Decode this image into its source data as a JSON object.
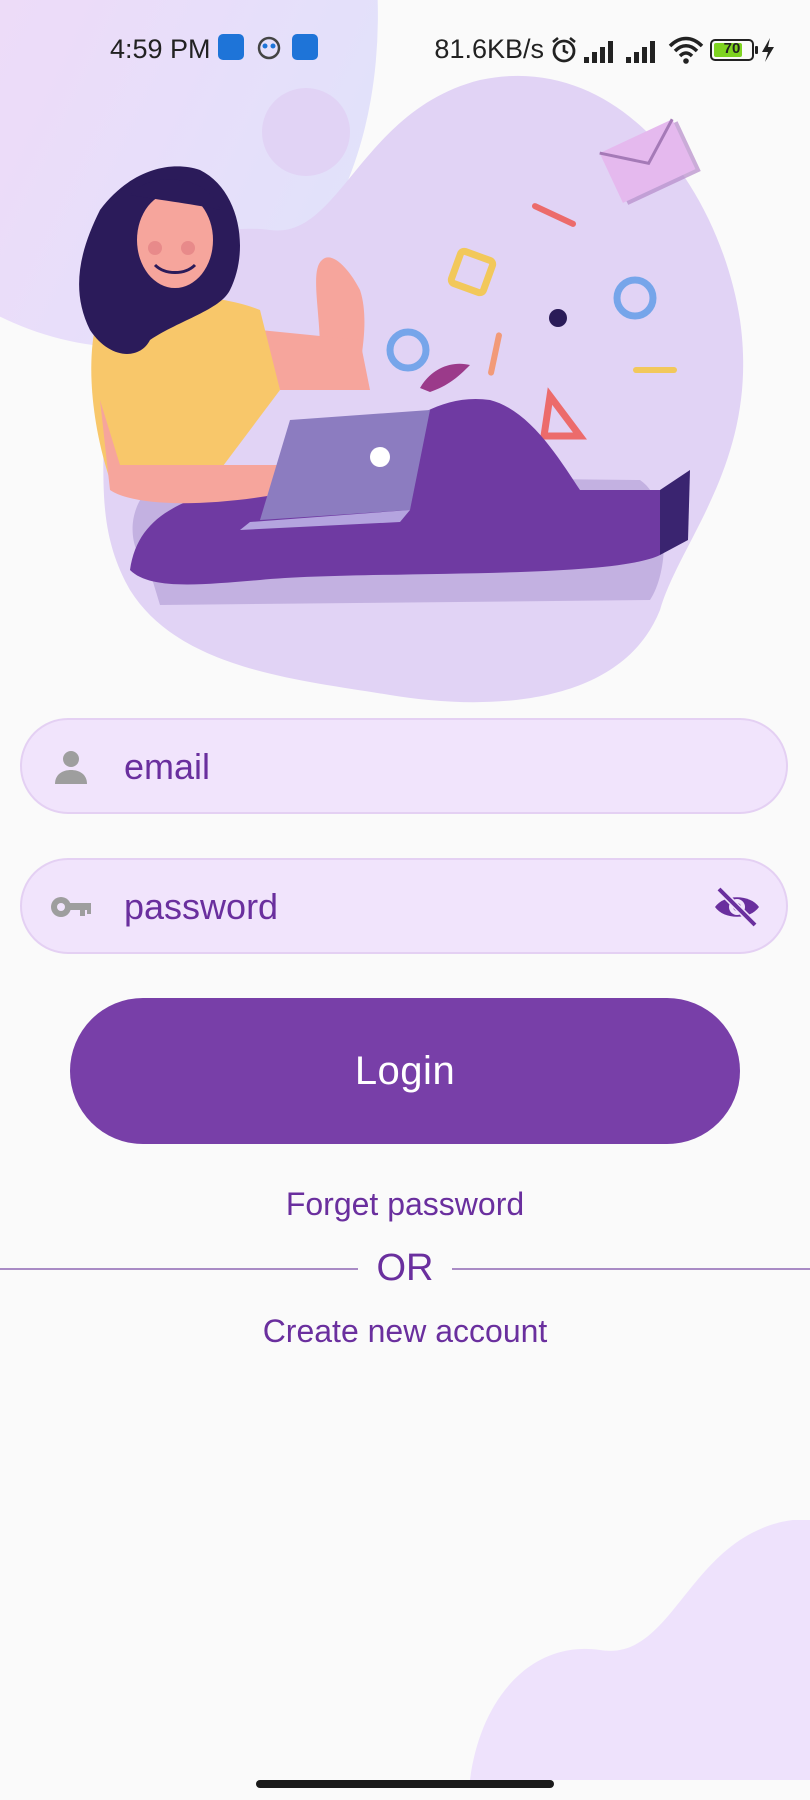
{
  "status_bar": {
    "time": "4:59 PM",
    "network_speed": "81.6KB/s",
    "battery_level": "70",
    "icons": [
      "notification-app-icon",
      "notification-app2-icon",
      "notification-app3-icon",
      "alarm-icon",
      "signal-icon",
      "signal2-icon",
      "wifi-icon",
      "battery-icon",
      "charging-icon"
    ]
  },
  "login": {
    "email_placeholder": "email",
    "password_placeholder": "password",
    "login_button": "Login",
    "forgot_link": "Forget password",
    "or_text": "OR",
    "create_account_link": "Create new account"
  },
  "colors": {
    "primary": "#783fa8",
    "field_bg": "#f1e4fc",
    "text_accent": "#6a2f9e",
    "icon_gray": "#9e9e9e"
  }
}
